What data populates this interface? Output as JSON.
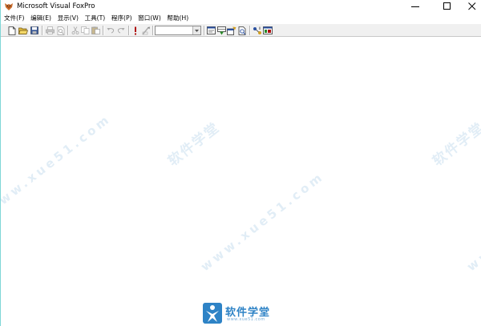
{
  "window": {
    "title": "Microsoft Visual FoxPro"
  },
  "menu": [
    {
      "label": "文件(F)"
    },
    {
      "label": "编辑(E)"
    },
    {
      "label": "显示(V)"
    },
    {
      "label": "工具(T)"
    },
    {
      "label": "程序(P)"
    },
    {
      "label": "窗口(W)"
    },
    {
      "label": "帮助(H)"
    }
  ],
  "toolbar": {
    "object_combo_value": "",
    "icons": [
      "new-file-icon",
      "open-folder-icon",
      "save-icon",
      "print-icon",
      "print-preview-icon",
      "cut-icon",
      "copy-icon",
      "paste-icon",
      "undo-icon",
      "redo-icon",
      "run-icon",
      "modify-form-icon",
      "command-window-icon",
      "data-session-icon",
      "form-wizard-icon",
      "report-icon",
      "connection-icon",
      "help-icon"
    ]
  },
  "watermark": {
    "cn_text": "软件学堂",
    "url_text": "www.xue51.com",
    "brand_text": "软件学堂",
    "brand_sub": "www.xue51.com"
  },
  "colors": {
    "toolbar_bg": "#f0f0f0",
    "accent_border": "#7fd6d6",
    "brand_blue": "#2e83c6"
  }
}
